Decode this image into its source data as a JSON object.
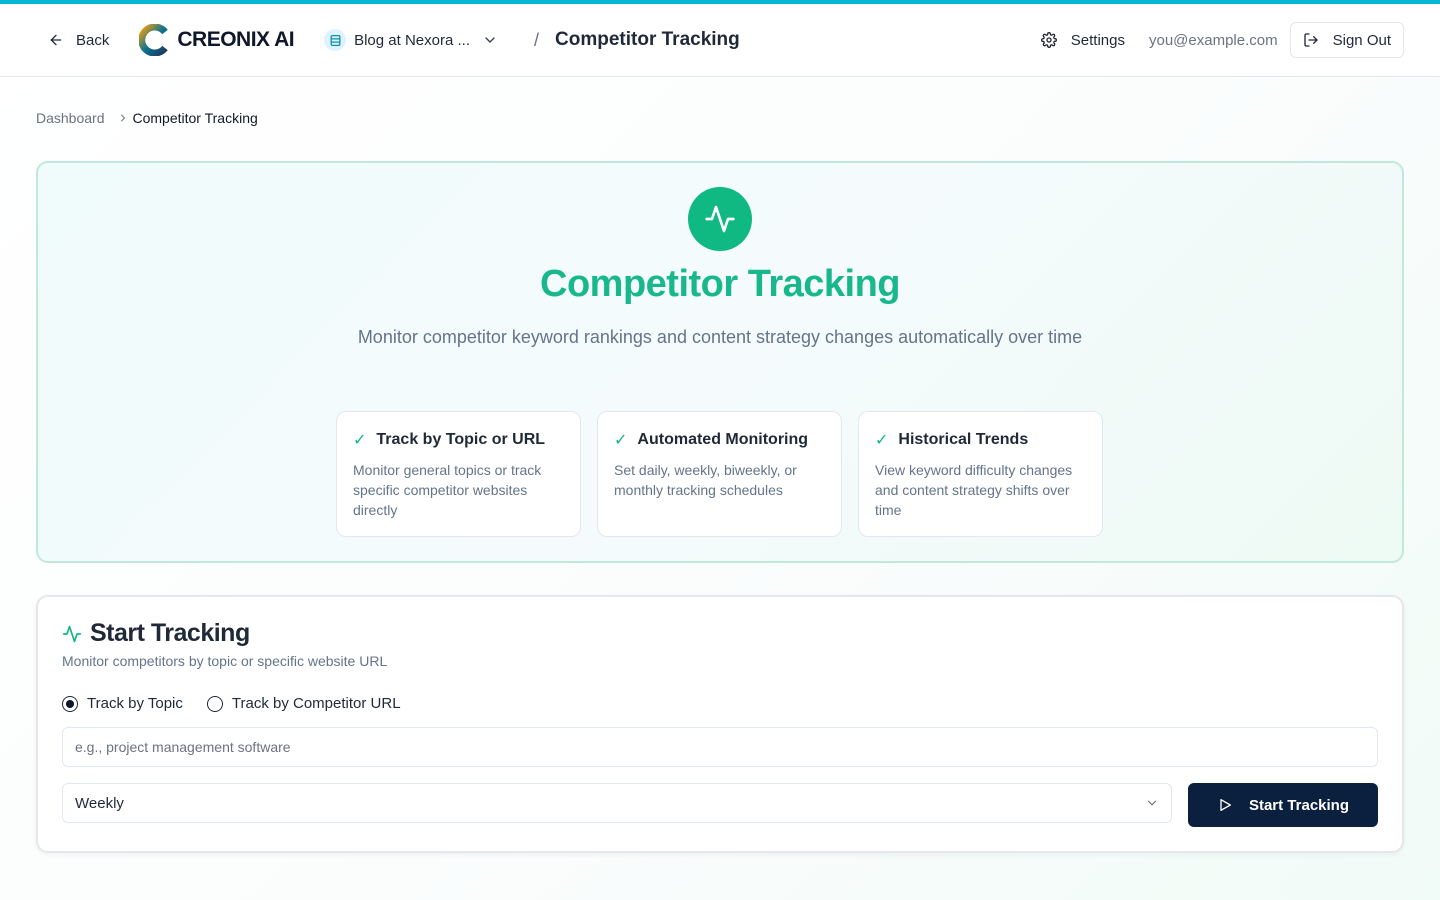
{
  "header": {
    "back_label": "Back",
    "logo_text": "CREONIX AI",
    "project_name": "Blog at Nexora ...",
    "separator": "/",
    "page_title": "Competitor Tracking",
    "settings_label": "Settings",
    "user_email": "you@example.com",
    "signout_label": "Sign Out"
  },
  "breadcrumb": {
    "items": [
      "Dashboard",
      "Competitor Tracking"
    ]
  },
  "hero": {
    "title": "Competitor Tracking",
    "subtitle": "Monitor competitor keyword rankings and content strategy changes automatically over time",
    "features": [
      {
        "title": "Track by Topic or URL",
        "description": "Monitor general topics or track specific competitor websites directly"
      },
      {
        "title": "Automated Monitoring",
        "description": "Set daily, weekly, biweekly, or monthly tracking schedules"
      },
      {
        "title": "Historical Trends",
        "description": "View keyword difficulty changes and content strategy shifts over time"
      }
    ],
    "check_glyph": "✓"
  },
  "tracking": {
    "title": "Start Tracking",
    "subtitle": "Monitor competitors by topic or specific website URL",
    "mode_options": [
      "Track by Topic",
      "Track by Competitor URL"
    ],
    "selected_mode": "Track by Topic",
    "topic_placeholder": "e.g., project management software",
    "topic_value": "",
    "frequency": "Weekly",
    "start_label": "Start Tracking"
  },
  "colors": {
    "accent_bar": "#06b6d4",
    "brand_green": "#10b981",
    "primary_button": "#0b1f3f"
  },
  "icons": {
    "back": "arrow-left-icon",
    "project": "database-icon",
    "settings": "gear-icon",
    "signout": "log-out-icon",
    "hero": "activity-icon",
    "start": "play-icon"
  }
}
